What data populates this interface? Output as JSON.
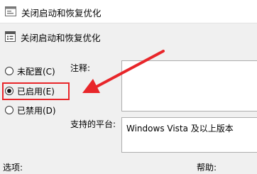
{
  "window": {
    "title": "关闭启动和恢复优化"
  },
  "header": {
    "title": "关闭启动和恢复优化"
  },
  "options": [
    {
      "label": "未配置(C)",
      "checked": false
    },
    {
      "label": "已启用(E)",
      "checked": true
    },
    {
      "label": "已禁用(D)",
      "checked": false
    }
  ],
  "comment": {
    "label": "注释:",
    "value": ""
  },
  "supported_on": {
    "label": "支持的平台:",
    "value": "Windows Vista 及以上版本"
  },
  "footer": {
    "options_label": "选项:",
    "help_label": "帮助:"
  },
  "colors": {
    "annotation": "#e8262a"
  }
}
